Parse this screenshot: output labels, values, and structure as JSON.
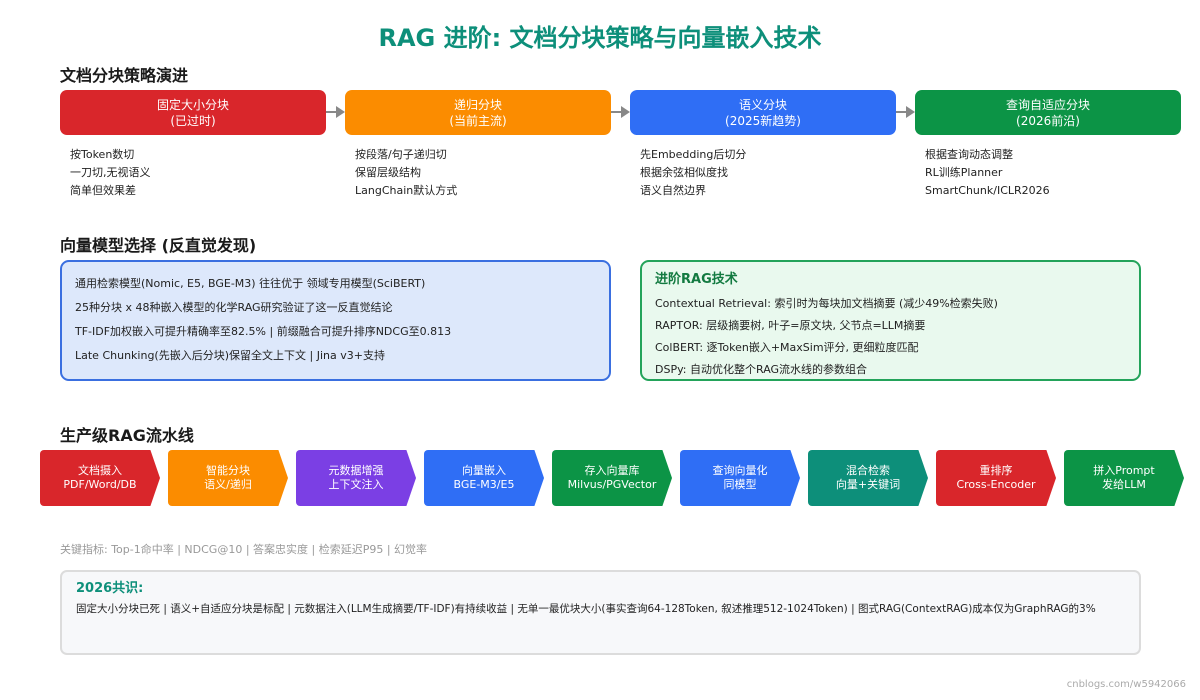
{
  "title": "RAG 进阶: 文档分块策略与向量嵌入技术",
  "section1": {
    "title": "文档分块策略演进",
    "stages": [
      {
        "name": "固定大小分块",
        "sub": "(已过时)",
        "color": "#d9262b",
        "notes": [
          "按Token数切",
          "一刀切,无视语义",
          "简单但效果差"
        ]
      },
      {
        "name": "递归分块",
        "sub": "(当前主流)",
        "color": "#fb8c00",
        "notes": [
          "按段落/句子递归切",
          "保留层级结构",
          "LangChain默认方式"
        ]
      },
      {
        "name": "语义分块",
        "sub": "(2025新趋势)",
        "color": "#2f6ef5",
        "notes": [
          "先Embedding后切分",
          "根据余弦相似度找",
          "语义自然边界"
        ]
      },
      {
        "name": "查询自适应分块",
        "sub": "(2026前沿)",
        "color": "#0c9446",
        "notes": [
          "根据查询动态调整",
          "RL训练Planner",
          "SmartChunk/ICLR2026"
        ]
      }
    ]
  },
  "section2": {
    "title": "向量模型选择 (反直觉发现)",
    "left_lines": [
      "通用检索模型(Nomic, E5, BGE-M3) 往往优于 领域专用模型(SciBERT)",
      "25种分块 x 48种嵌入模型的化学RAG研究验证了这一反直觉结论",
      "TF-IDF加权嵌入可提升精确率至82.5% | 前缀融合可提升排序NDCG至0.813",
      "Late Chunking(先嵌入后分块)保留全文上下文 | Jina v3+支持"
    ],
    "right_heading": "进阶RAG技术",
    "right_lines": [
      "Contextual Retrieval: 索引时为每块加文档摘要 (减少49%检索失败)",
      "RAPTOR: 层级摘要树, 叶子=原文块, 父节点=LLM摘要",
      "ColBERT: 逐Token嵌入+MaxSim评分, 更细粒度匹配",
      "DSPy: 自动优化整个RAG流水线的参数组合"
    ]
  },
  "section3": {
    "title": "生产级RAG流水线",
    "steps": [
      {
        "line1": "文档摄入",
        "line2": "PDF/Word/DB",
        "color": "#d9262b"
      },
      {
        "line1": "智能分块",
        "line2": "语义/递归",
        "color": "#fb8c00"
      },
      {
        "line1": "元数据增强",
        "line2": "上下文注入",
        "color": "#7b3fe4"
      },
      {
        "line1": "向量嵌入",
        "line2": "BGE-M3/E5",
        "color": "#2f6ef5"
      },
      {
        "line1": "存入向量库",
        "line2": "Milvus/PGVector",
        "color": "#0c9446"
      },
      {
        "line1": "查询向量化",
        "line2": "同模型",
        "color": "#2f6ef5"
      },
      {
        "line1": "混合检索",
        "line2": "向量+关键词",
        "color": "#0d8f7a"
      },
      {
        "line1": "重排序",
        "line2": "Cross-Encoder",
        "color": "#d9262b"
      },
      {
        "line1": "拼入Prompt",
        "line2": "发给LLM",
        "color": "#0c9446"
      }
    ],
    "metrics": "关键指标: Top-1命中率 | NDCG@10 | 答案忠实度 | 检索延迟P95 | 幻觉率"
  },
  "consensus": {
    "title": "2026共识:",
    "text": "固定大小分块已死 | 语义+自适应分块是标配 | 元数据注入(LLM生成摘要/TF-IDF)有持续收益 | 无单一最优块大小(事实查询64-128Token, 叙述推理512-1024Token) | 图式RAG(ContextRAG)成本仅为GraphRAG的3%"
  },
  "watermark": "cnblogs.com/w5942066"
}
